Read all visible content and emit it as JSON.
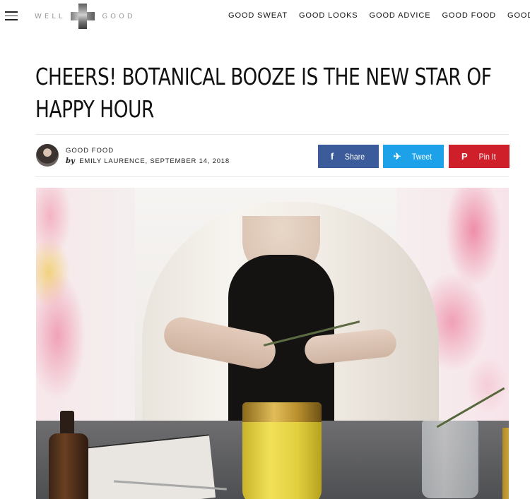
{
  "header": {
    "logo_left": "WELL",
    "logo_right": "GOOD",
    "nav": [
      "GOOD SWEAT",
      "GOOD LOOKS",
      "GOOD ADVICE",
      "GOOD FOOD",
      "GOOD TI"
    ]
  },
  "article": {
    "title": "CHEERS! BOTANICAL BOOZE IS THE NEW STAR OF HAPPY HOUR",
    "category": "GOOD FOOD",
    "by": "by",
    "author_date": "EMILY LAURENCE, SEPTEMBER 14, 2018"
  },
  "share": {
    "facebook": {
      "icon": "f",
      "label": "Share",
      "color": "#3b5b9a"
    },
    "twitter": {
      "icon": "✈",
      "label": "Tweet",
      "color": "#1da1e8"
    },
    "pinterest": {
      "icon": "P",
      "label": "Pin It",
      "color": "#cf1f2a"
    }
  },
  "icons": {
    "menu": "hamburger-icon",
    "logo": "well-good-logo-icon"
  }
}
